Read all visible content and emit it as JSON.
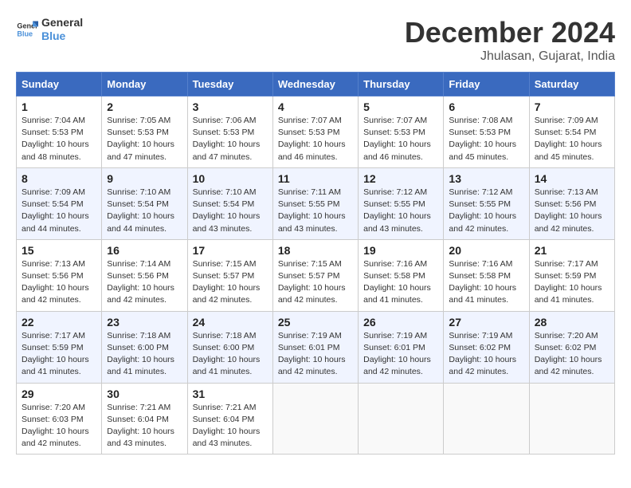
{
  "logo": {
    "name_part1": "General",
    "name_part2": "Blue"
  },
  "title": "December 2024",
  "location": "Jhulasan, Gujarat, India",
  "days_of_week": [
    "Sunday",
    "Monday",
    "Tuesday",
    "Wednesday",
    "Thursday",
    "Friday",
    "Saturday"
  ],
  "weeks": [
    [
      {
        "day": "1",
        "sunrise": "Sunrise: 7:04 AM",
        "sunset": "Sunset: 5:53 PM",
        "daylight": "Daylight: 10 hours and 48 minutes."
      },
      {
        "day": "2",
        "sunrise": "Sunrise: 7:05 AM",
        "sunset": "Sunset: 5:53 PM",
        "daylight": "Daylight: 10 hours and 47 minutes."
      },
      {
        "day": "3",
        "sunrise": "Sunrise: 7:06 AM",
        "sunset": "Sunset: 5:53 PM",
        "daylight": "Daylight: 10 hours and 47 minutes."
      },
      {
        "day": "4",
        "sunrise": "Sunrise: 7:07 AM",
        "sunset": "Sunset: 5:53 PM",
        "daylight": "Daylight: 10 hours and 46 minutes."
      },
      {
        "day": "5",
        "sunrise": "Sunrise: 7:07 AM",
        "sunset": "Sunset: 5:53 PM",
        "daylight": "Daylight: 10 hours and 46 minutes."
      },
      {
        "day": "6",
        "sunrise": "Sunrise: 7:08 AM",
        "sunset": "Sunset: 5:53 PM",
        "daylight": "Daylight: 10 hours and 45 minutes."
      },
      {
        "day": "7",
        "sunrise": "Sunrise: 7:09 AM",
        "sunset": "Sunset: 5:54 PM",
        "daylight": "Daylight: 10 hours and 45 minutes."
      }
    ],
    [
      {
        "day": "8",
        "sunrise": "Sunrise: 7:09 AM",
        "sunset": "Sunset: 5:54 PM",
        "daylight": "Daylight: 10 hours and 44 minutes."
      },
      {
        "day": "9",
        "sunrise": "Sunrise: 7:10 AM",
        "sunset": "Sunset: 5:54 PM",
        "daylight": "Daylight: 10 hours and 44 minutes."
      },
      {
        "day": "10",
        "sunrise": "Sunrise: 7:10 AM",
        "sunset": "Sunset: 5:54 PM",
        "daylight": "Daylight: 10 hours and 43 minutes."
      },
      {
        "day": "11",
        "sunrise": "Sunrise: 7:11 AM",
        "sunset": "Sunset: 5:55 PM",
        "daylight": "Daylight: 10 hours and 43 minutes."
      },
      {
        "day": "12",
        "sunrise": "Sunrise: 7:12 AM",
        "sunset": "Sunset: 5:55 PM",
        "daylight": "Daylight: 10 hours and 43 minutes."
      },
      {
        "day": "13",
        "sunrise": "Sunrise: 7:12 AM",
        "sunset": "Sunset: 5:55 PM",
        "daylight": "Daylight: 10 hours and 42 minutes."
      },
      {
        "day": "14",
        "sunrise": "Sunrise: 7:13 AM",
        "sunset": "Sunset: 5:56 PM",
        "daylight": "Daylight: 10 hours and 42 minutes."
      }
    ],
    [
      {
        "day": "15",
        "sunrise": "Sunrise: 7:13 AM",
        "sunset": "Sunset: 5:56 PM",
        "daylight": "Daylight: 10 hours and 42 minutes."
      },
      {
        "day": "16",
        "sunrise": "Sunrise: 7:14 AM",
        "sunset": "Sunset: 5:56 PM",
        "daylight": "Daylight: 10 hours and 42 minutes."
      },
      {
        "day": "17",
        "sunrise": "Sunrise: 7:15 AM",
        "sunset": "Sunset: 5:57 PM",
        "daylight": "Daylight: 10 hours and 42 minutes."
      },
      {
        "day": "18",
        "sunrise": "Sunrise: 7:15 AM",
        "sunset": "Sunset: 5:57 PM",
        "daylight": "Daylight: 10 hours and 42 minutes."
      },
      {
        "day": "19",
        "sunrise": "Sunrise: 7:16 AM",
        "sunset": "Sunset: 5:58 PM",
        "daylight": "Daylight: 10 hours and 41 minutes."
      },
      {
        "day": "20",
        "sunrise": "Sunrise: 7:16 AM",
        "sunset": "Sunset: 5:58 PM",
        "daylight": "Daylight: 10 hours and 41 minutes."
      },
      {
        "day": "21",
        "sunrise": "Sunrise: 7:17 AM",
        "sunset": "Sunset: 5:59 PM",
        "daylight": "Daylight: 10 hours and 41 minutes."
      }
    ],
    [
      {
        "day": "22",
        "sunrise": "Sunrise: 7:17 AM",
        "sunset": "Sunset: 5:59 PM",
        "daylight": "Daylight: 10 hours and 41 minutes."
      },
      {
        "day": "23",
        "sunrise": "Sunrise: 7:18 AM",
        "sunset": "Sunset: 6:00 PM",
        "daylight": "Daylight: 10 hours and 41 minutes."
      },
      {
        "day": "24",
        "sunrise": "Sunrise: 7:18 AM",
        "sunset": "Sunset: 6:00 PM",
        "daylight": "Daylight: 10 hours and 41 minutes."
      },
      {
        "day": "25",
        "sunrise": "Sunrise: 7:19 AM",
        "sunset": "Sunset: 6:01 PM",
        "daylight": "Daylight: 10 hours and 42 minutes."
      },
      {
        "day": "26",
        "sunrise": "Sunrise: 7:19 AM",
        "sunset": "Sunset: 6:01 PM",
        "daylight": "Daylight: 10 hours and 42 minutes."
      },
      {
        "day": "27",
        "sunrise": "Sunrise: 7:19 AM",
        "sunset": "Sunset: 6:02 PM",
        "daylight": "Daylight: 10 hours and 42 minutes."
      },
      {
        "day": "28",
        "sunrise": "Sunrise: 7:20 AM",
        "sunset": "Sunset: 6:02 PM",
        "daylight": "Daylight: 10 hours and 42 minutes."
      }
    ],
    [
      {
        "day": "29",
        "sunrise": "Sunrise: 7:20 AM",
        "sunset": "Sunset: 6:03 PM",
        "daylight": "Daylight: 10 hours and 42 minutes."
      },
      {
        "day": "30",
        "sunrise": "Sunrise: 7:21 AM",
        "sunset": "Sunset: 6:04 PM",
        "daylight": "Daylight: 10 hours and 43 minutes."
      },
      {
        "day": "31",
        "sunrise": "Sunrise: 7:21 AM",
        "sunset": "Sunset: 6:04 PM",
        "daylight": "Daylight: 10 hours and 43 minutes."
      },
      null,
      null,
      null,
      null
    ]
  ]
}
